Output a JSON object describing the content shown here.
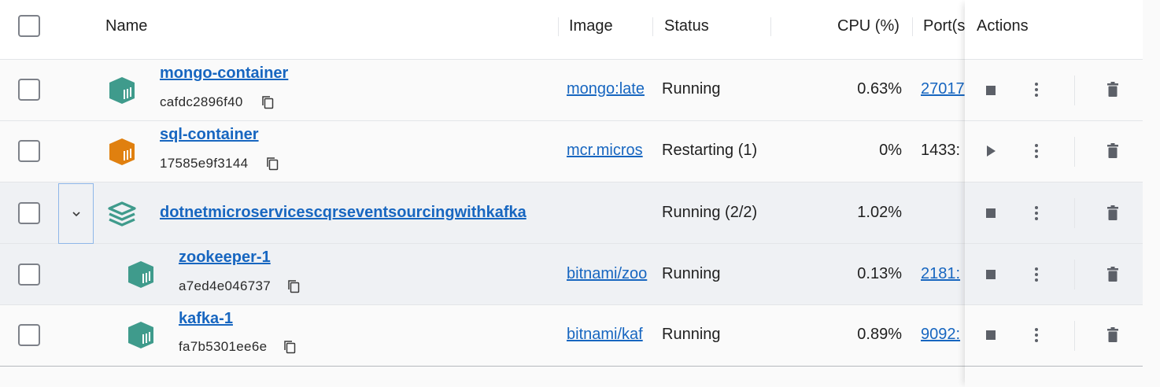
{
  "header": {
    "name": "Name",
    "image": "Image",
    "status": "Status",
    "cpu": "CPU (%)",
    "ports": "Port(s",
    "actions": "Actions"
  },
  "rows": [
    {
      "name": "mongo-container",
      "id": "cafdc2896f40",
      "image": "mongo:late",
      "status": "Running",
      "cpu": "0.63%",
      "port": "27017",
      "icon_color": "#3f9b8c",
      "action": "stop"
    },
    {
      "name": "sql-container",
      "id": "17585e9f3144",
      "image": "mcr.micros",
      "status": "Restarting (1)",
      "cpu": "0%",
      "port": "1433:",
      "icon_color": "#e0800f",
      "action": "play"
    },
    {
      "name": "dotnetmicroservicescqrseventsourcingwithkafka",
      "status": "Running (2/2)",
      "cpu": "1.02%",
      "icon_color": "#3f9b8c",
      "action": "stop"
    },
    {
      "name": "zookeeper-1",
      "id": "a7ed4e046737",
      "image": "bitnami/zoo",
      "status": "Running",
      "cpu": "0.13%",
      "port": "2181:",
      "icon_color": "#3f9b8c",
      "action": "stop"
    },
    {
      "name": "kafka-1",
      "id": "fa7b5301ee6e",
      "image": "bitnami/kaf",
      "status": "Running",
      "cpu": "0.89%",
      "port": "9092:",
      "icon_color": "#3f9b8c",
      "action": "stop"
    }
  ]
}
